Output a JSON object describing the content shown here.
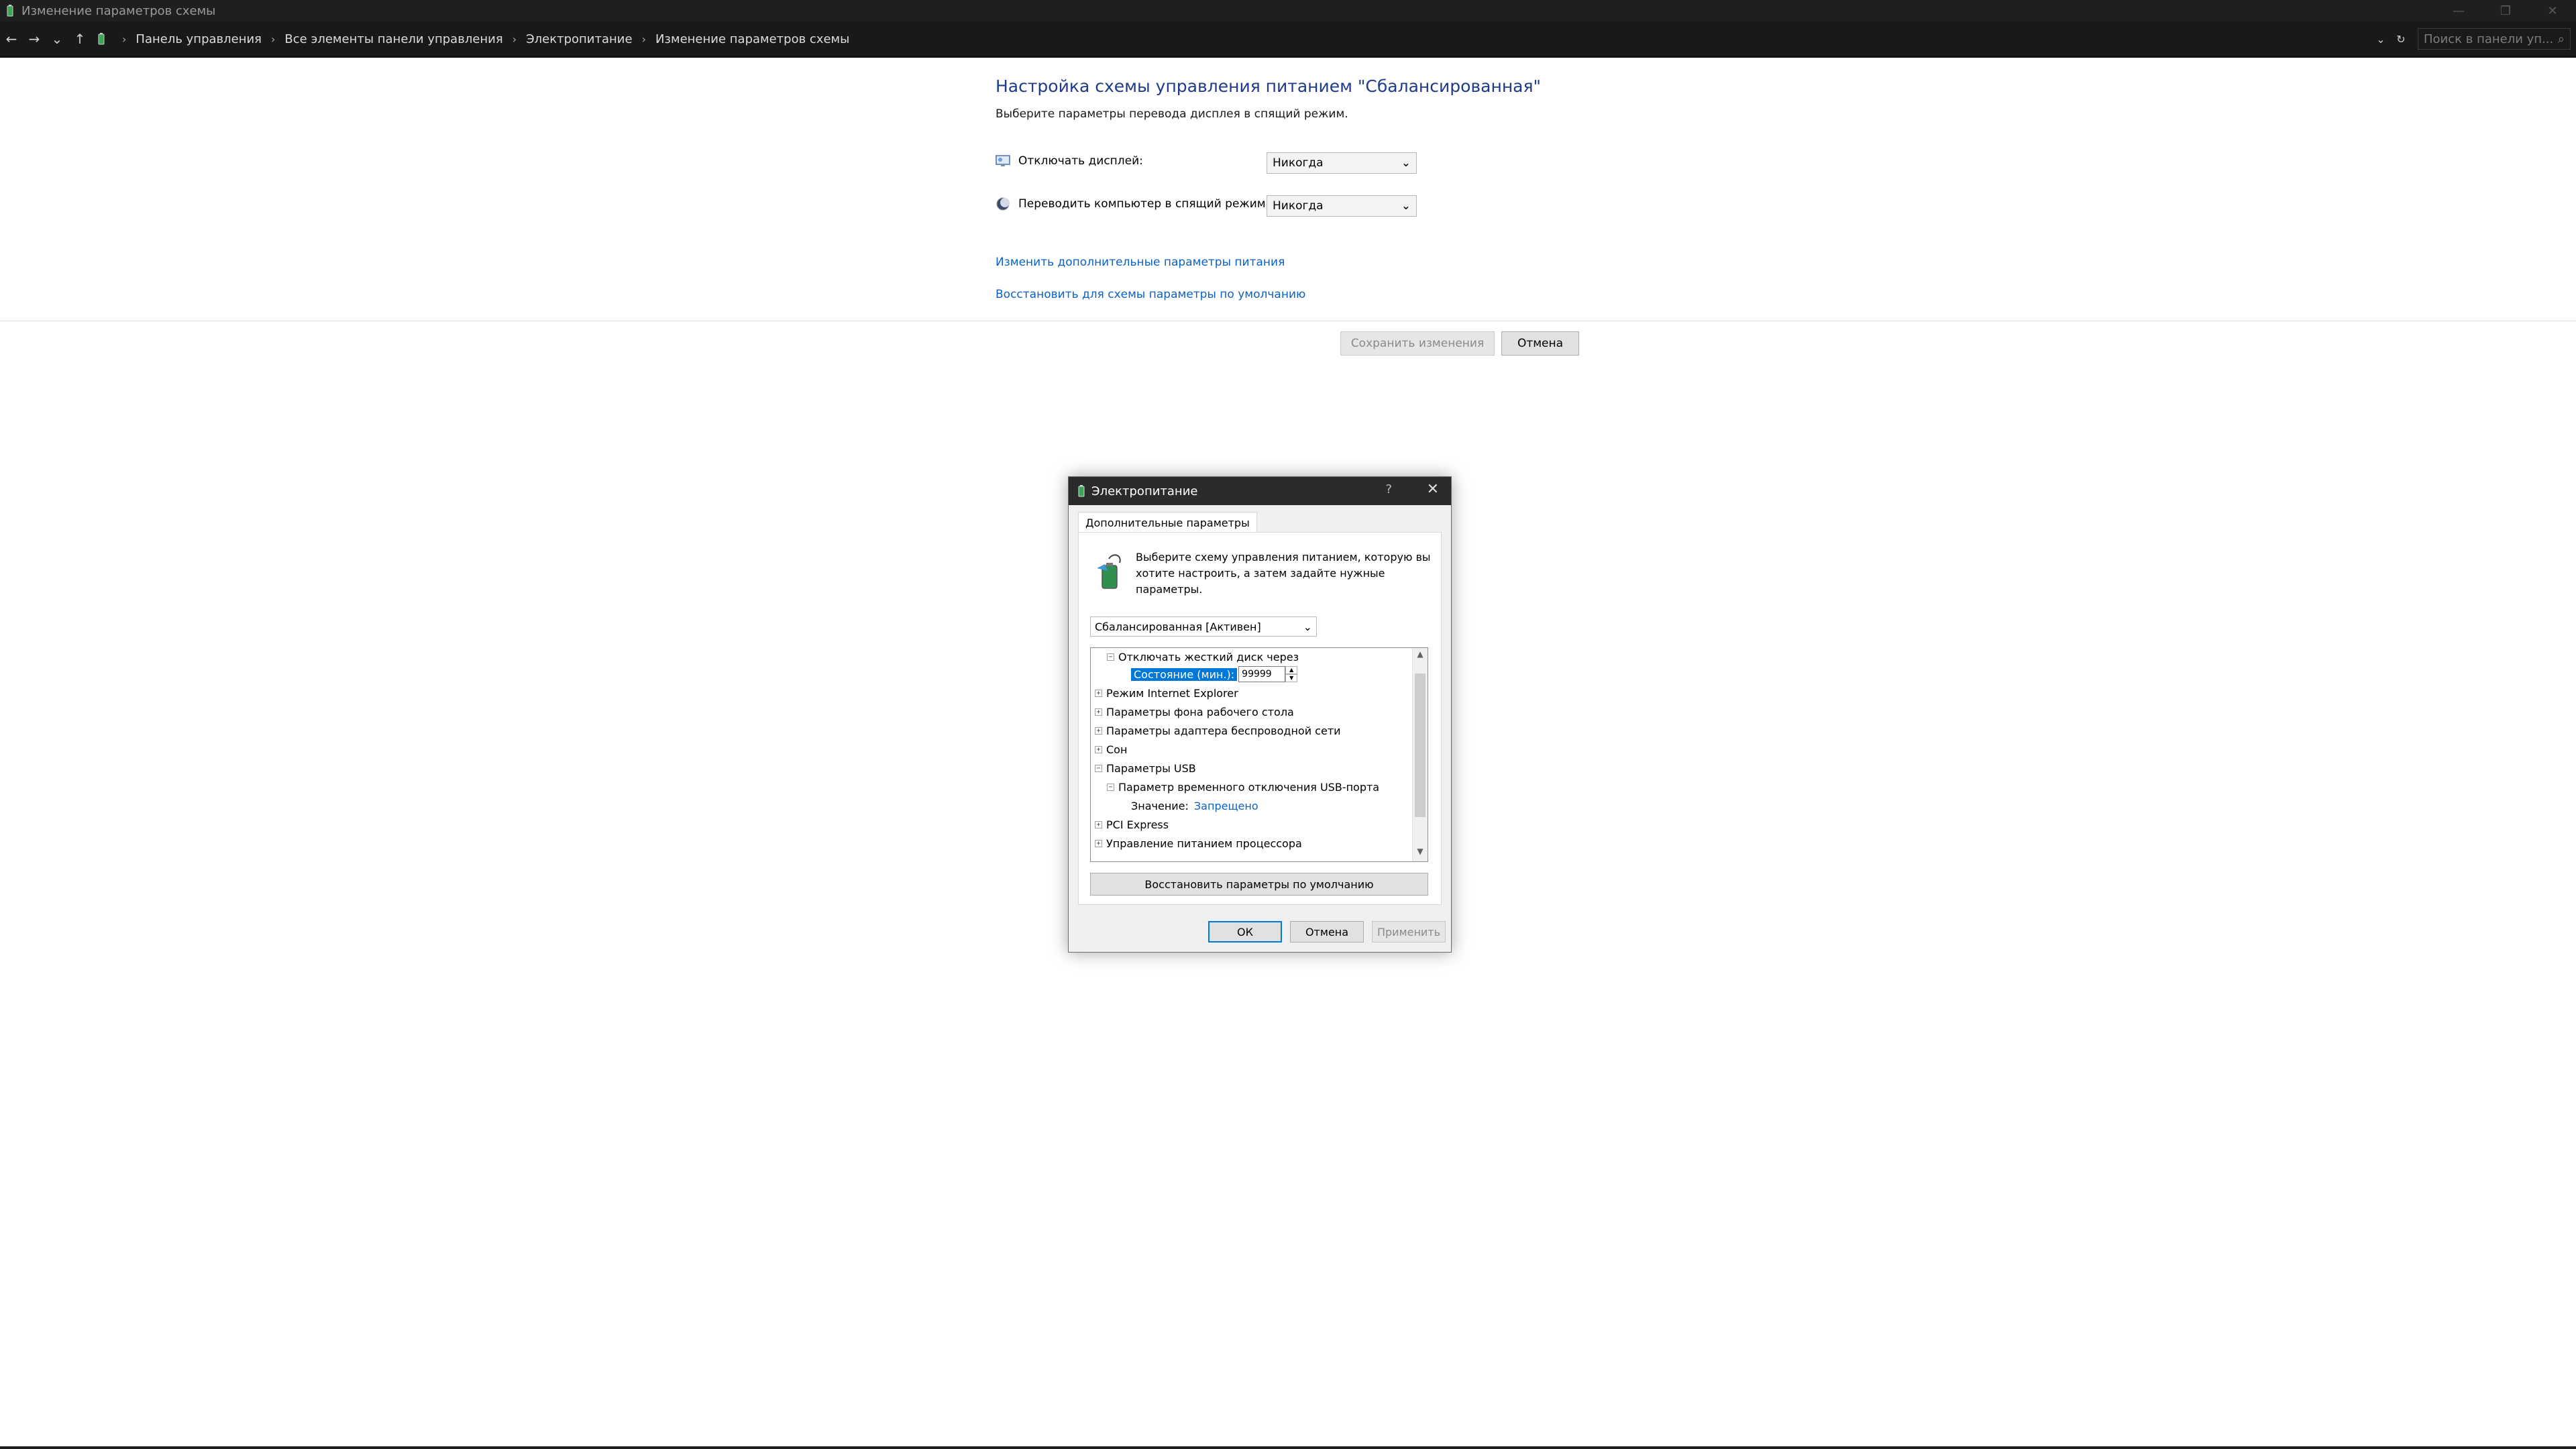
{
  "window": {
    "title": "Изменение параметров схемы",
    "controls": [
      "—",
      "❐",
      "✕"
    ]
  },
  "address_bar": {
    "back": "←",
    "forward": "→",
    "recent": "⌄",
    "up": "↑",
    "breadcrumbs": [
      "Панель управления",
      "Все элементы панели управления",
      "Электропитание",
      "Изменение параметров схемы"
    ],
    "dropdown": "⌄",
    "refresh": "↻",
    "search_placeholder": "Поиск в панели уп...",
    "search_icon": "⌕"
  },
  "main": {
    "title": "Настройка схемы управления питанием \"Сбалансированная\"",
    "subtitle": "Выберите параметры перевода дисплея в спящий режим.",
    "display_off": {
      "label": "Отключать дисплей:",
      "value": "Никогда"
    },
    "sleep": {
      "label": "Переводить компьютер в спящий режим:",
      "value": "Никогда"
    },
    "link_advanced": "Изменить дополнительные параметры питания",
    "link_restore": "Восстановить для схемы параметры по умолчанию",
    "save_button": "Сохранить изменения",
    "cancel_button": "Отмена"
  },
  "dialog": {
    "title": "Электропитание",
    "help": "?",
    "close": "✕",
    "tab": "Дополнительные параметры",
    "description": "Выберите схему управления питанием, которую вы хотите настроить, а затем задайте нужные параметры.",
    "plan_select": "Сбалансированная [Активен]",
    "tree": {
      "item_disk": "Отключать жесткий диск через",
      "state_label": "Состояние (мин.):",
      "state_value": "99999",
      "ie_mode": "Режим Internet Explorer",
      "desktop_bg": "Параметры фона рабочего стола",
      "wireless": "Параметры адаптера беспроводной сети",
      "sleep": "Сон",
      "usb": "Параметры USB",
      "usb_suspend": "Параметр временного отключения USB-порта",
      "value_label": "Значение:",
      "value_link": "Запрещено",
      "pci": "PCI Express",
      "cpu": "Управление питанием процессора"
    },
    "restore_defaults": "Восстановить параметры по умолчанию",
    "ok": "ОК",
    "cancel": "Отмена",
    "apply": "Применить"
  }
}
